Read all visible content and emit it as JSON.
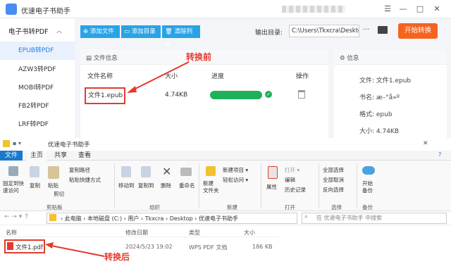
{
  "app": {
    "title": "优速电子书助手",
    "window_controls": [
      "☰",
      "—",
      "□",
      "✕"
    ],
    "sidebar": {
      "header": "电子书转PDF",
      "items": [
        "EPUB转PDF",
        "AZW3转PDF",
        "MOBI转PDF",
        "FB2转PDF",
        "LRF转PDF"
      ],
      "active_index": 0
    },
    "toolbar": {
      "add_file": "添加文件",
      "add_dir": "添加目录",
      "clear_list": "清除列表",
      "output_label": "输出目录:",
      "output_path": "C:\\Users\\Tkxcra\\Deskto",
      "more": "···",
      "start": "开始转换"
    },
    "file_panel": {
      "title": "文件信息",
      "columns": [
        "文件名称",
        "大小",
        "进度",
        "操作"
      ],
      "row": {
        "name": "文件1.epub",
        "size": "4.74KB",
        "progress": 1.0
      }
    },
    "info_panel": {
      "title": "信息",
      "rows": [
        "文件: 文件1.epub",
        "书名: æ–°å»º",
        "格式: epub",
        "大小: 4.74KB"
      ]
    },
    "annotation_before": "转换前"
  },
  "explorer": {
    "title": "优速电子书助手",
    "tabs": [
      "文件",
      "主页",
      "共享",
      "查看"
    ],
    "ribbon": {
      "pin": "固定到快\n速访问",
      "copy": "复制",
      "paste": "粘贴",
      "copy_path": "复制路径",
      "paste_shortcut": "粘贴快捷方式",
      "cut": "剪切",
      "clipboard": "剪贴板",
      "move_to": "移动到",
      "copy_to": "复制到",
      "delete": "删除",
      "rename": "重命名",
      "organize": "组织",
      "new_folder": "新建\n文件夹",
      "new_item": "新建项目 ▾",
      "easy_access": "轻松访问 ▾",
      "new": "新建",
      "properties": "属性",
      "open": "打开 ▾",
      "edit": "编辑",
      "history": "历史记录",
      "open_group": "打开",
      "select_all": "全部选择",
      "select_none": "全部取消",
      "invert": "反向选择",
      "select": "选择",
      "start_backup": "开始\n备份",
      "backup": "备份"
    },
    "breadcrumb": [
      "此电脑",
      "本地磁盘 (C:)",
      "用户",
      "Tkxcra",
      "Desktop",
      "优速电子书助手"
    ],
    "search_placeholder": "在 优速电子书助手 中搜索",
    "columns": [
      "名称",
      "修改日期",
      "类型",
      "大小"
    ],
    "file": {
      "name": "文件1.pdf",
      "date": "2024/5/23 19:02",
      "type": "WPS PDF 文档",
      "size": "186 KB"
    },
    "annotation_after": "转换后"
  },
  "colors": {
    "accent": "#2aa3e6",
    "start": "#f5641e",
    "progress": "#1fb05a",
    "annotation": "#e23b2e",
    "explorer_blue": "#1979ca"
  }
}
